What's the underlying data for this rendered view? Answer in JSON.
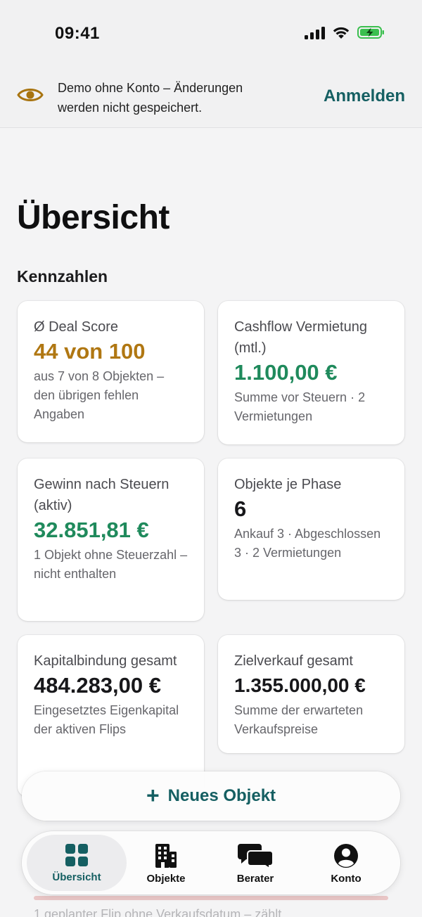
{
  "status_bar": {
    "time": "09:41"
  },
  "banner": {
    "icon": "eye-icon",
    "text": "Demo ohne Konto – Änderungen werden nicht gespeichert.",
    "login_label": "Anmelden"
  },
  "page": {
    "title": "Übersicht",
    "section_title": "Kennzahlen"
  },
  "cards": [
    {
      "label": "Ø Deal Score",
      "value": "44 von 100",
      "sub": "aus 7 von 8 Objekten – den übrigen fehlen Angaben",
      "color": "#b07712"
    },
    {
      "label": "Cashflow Vermietung (mtl.)",
      "value": "1.100,00 €",
      "sub": "Summe vor Steuern · 2 Vermietungen",
      "color": "#1f8a5c"
    },
    {
      "label": "Gewinn nach Steuern (aktiv)",
      "value": "32.851,81 €",
      "sub": "1 Objekt ohne Steuerzahl – nicht enthalten",
      "color": "#1f8a5c"
    },
    {
      "label": "Objekte je Phase",
      "value": "6",
      "sub": "Ankauf 3 · Abgeschlossen 3 · 2 Vermietungen",
      "color": "#17171a"
    },
    {
      "label": "Kapitalbindung gesamt",
      "value": "484.283,00 €",
      "sub": "Eingesetztes Eigenkapital der aktiven Flips",
      "color": "#17171a"
    },
    {
      "label": "Zielverkauf gesamt",
      "value": "1.355.000,00 €",
      "sub": "Summe der erwarteten Verkaufspreise",
      "color": "#17171a"
    }
  ],
  "fab": {
    "label": "Neues Objekt",
    "icon": "plus-icon"
  },
  "tabs": [
    {
      "label": "Übersicht",
      "icon": "grid-icon",
      "active": true
    },
    {
      "label": "Objekte",
      "icon": "building-icon",
      "active": false
    },
    {
      "label": "Berater",
      "icon": "chat-bubbles-icon",
      "active": false
    },
    {
      "label": "Konto",
      "icon": "user-circle-icon",
      "active": false
    }
  ],
  "behind_text": "1 geplanter Flip ohne Verkaufsdatum – zählt",
  "colors": {
    "accent": "#155f62",
    "gold": "#b07712",
    "green": "#1f8a5c"
  }
}
